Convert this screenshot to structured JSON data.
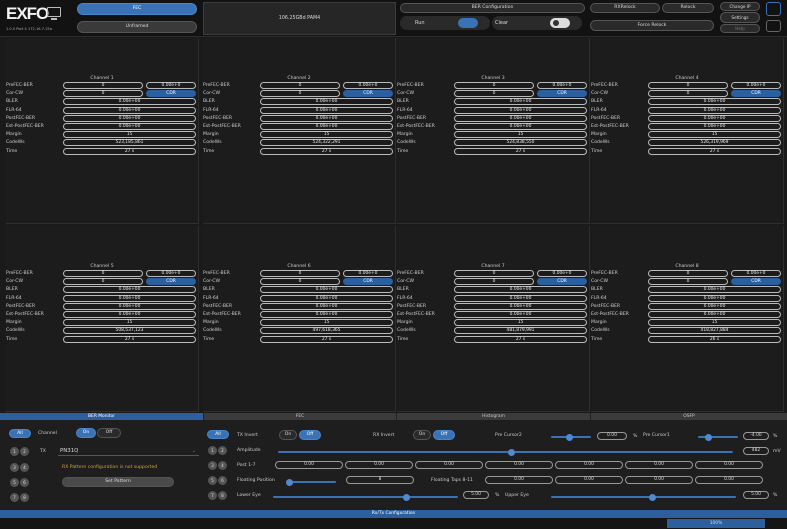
{
  "header": {
    "logo": "EXFO",
    "version": "1.0.0   Port 4   172.16.7.15a",
    "fec_label": "FEC",
    "unframed_label": "Unframed",
    "rate_label": "106.25GBd PAM4",
    "ber_config_label": "BER Configuration",
    "run_label": "Run",
    "clear_label": "Clear",
    "rxrelock_label": "RXRelock",
    "relock_label": "Relock",
    "force_relock_label": "Force Relock",
    "change_ip_label": "Change IP",
    "settings_label": "Settings",
    "help_label": "Help"
  },
  "row_labels": [
    "PreFEC-BER",
    "Cor-CW",
    "BLER",
    "FLR-64",
    "PostFEC-BER",
    "Est-PostFEC-BER",
    "Margin",
    "CodeWs",
    "Time"
  ],
  "cdr_label": "CDR",
  "channels": [
    {
      "title": "Channel 1",
      "prefec": "0",
      "prefec2": "0.00e+0",
      "corcw": "0",
      "bler": "0.00e+00",
      "flr": "0.00e+00",
      "postfec": "0.00e+00",
      "estpost": "0.00e+00",
      "margin": "15",
      "codews": "523,185,861",
      "time": "27 s"
    },
    {
      "title": "Channel 2",
      "prefec": "0",
      "prefec2": "0.00e+0",
      "corcw": "0",
      "bler": "0.00e+00",
      "flr": "0.00e+00",
      "postfec": "0.00e+00",
      "estpost": "0.00e+00",
      "margin": "15",
      "codews": "524,322,291",
      "time": "27 s"
    },
    {
      "title": "Channel 3",
      "prefec": "0",
      "prefec2": "0.00e+0",
      "corcw": "0",
      "bler": "0.00e+00",
      "flr": "0.00e+00",
      "postfec": "0.00e+00",
      "estpost": "0.00e+00",
      "margin": "15",
      "codews": "524,838,550",
      "time": "27 s"
    },
    {
      "title": "Channel 4",
      "prefec": "0",
      "prefec2": "0.00e+0",
      "corcw": "0",
      "bler": "0.00e+00",
      "flr": "0.00e+00",
      "postfec": "0.00e+00",
      "estpost": "0.00e+00",
      "margin": "15",
      "codews": "526,319,969",
      "time": "27 s"
    },
    {
      "title": "Channel 5",
      "prefec": "0",
      "prefec2": "0.00e+0",
      "corcw": "0",
      "bler": "0.00e+00",
      "flr": "0.00e+00",
      "postfec": "0.00e+00",
      "estpost": "0.00e+00",
      "margin": "15",
      "codews": "508,537,123",
      "time": "27 s"
    },
    {
      "title": "Channel 6",
      "prefec": "0",
      "prefec2": "0.00e+0",
      "corcw": "0",
      "bler": "0.00e+00",
      "flr": "0.00e+00",
      "postfec": "0.00e+00",
      "estpost": "0.00e+00",
      "margin": "15",
      "codews": "497,618,365",
      "time": "27 s"
    },
    {
      "title": "Channel 7",
      "prefec": "0",
      "prefec2": "0.00e+0",
      "corcw": "0",
      "bler": "0.00e+00",
      "flr": "0.00e+00",
      "postfec": "0.00e+00",
      "estpost": "0.00e+00",
      "margin": "15",
      "codews": "481,879,991",
      "time": "27 s"
    },
    {
      "title": "Channel 8",
      "prefec": "0",
      "prefec2": "0.00e+0",
      "corcw": "0",
      "bler": "0.00e+00",
      "flr": "0.00e+00",
      "postfec": "0.00e+00",
      "estpost": "0.00e+00",
      "margin": "15",
      "codews": "418,827,884",
      "time": "26 s"
    }
  ],
  "tabs": [
    "BER Monitor",
    "FEC",
    "Histogram",
    "OSFP"
  ],
  "ber_monitor": {
    "all_label": "All",
    "channel_label": "Channel",
    "on_label": "On",
    "off_label": "Off",
    "tx_label": "TX",
    "pattern_value": "PN31Q",
    "warning": "RX Pattern configuration is not supported",
    "set_pattern_label": "Set Pattern",
    "channel_numbers": [
      "1",
      "2",
      "3",
      "4",
      "5",
      "6",
      "7",
      "8"
    ]
  },
  "fec_panel": {
    "all_label": "All",
    "tx_invert_label": "TX Invert",
    "rx_invert_label": "RX Invert",
    "on_label": "On",
    "off_label": "Off",
    "pre_cursor2_label": "Pre Cursor2",
    "pre_cursor2_value": "0.00",
    "pre_cursor2_unit": "%",
    "pre_cursor1_label": "Pre Cursor1",
    "pre_cursor1_value": "-4.00",
    "pre_cursor1_unit": "%",
    "amplitude_label": "Amplitude",
    "amplitude_value": "482",
    "amplitude_unit": "mV",
    "post_label": "Post 1-7",
    "post_values": [
      "0.00",
      "0.00",
      "0.00",
      "0.00",
      "0.00",
      "0.00",
      "0.00"
    ],
    "floating_position_label": "Floating Position",
    "floating_position_value": "8",
    "floating_taps_label": "Floating Taps 8-11",
    "floating_taps_values": [
      "0.00",
      "0.00",
      "0.00",
      "0.00"
    ],
    "lower_eye_label": "Lower Eye",
    "lower_eye_value": "5.00",
    "lower_eye_unit": "%",
    "upper_eye_label": "Upper Eye",
    "upper_eye_value": "5.00",
    "upper_eye_unit": "%",
    "pair_numbers": [
      "1",
      "2",
      "3",
      "4",
      "5",
      "6",
      "7",
      "8"
    ]
  },
  "footer": {
    "label": "Rx/Tx Configuration",
    "progress": "100%"
  },
  "colors": {
    "accent": "#3a73b5",
    "warning": "#d9a030",
    "panel_bg": "#1c1c1c"
  }
}
